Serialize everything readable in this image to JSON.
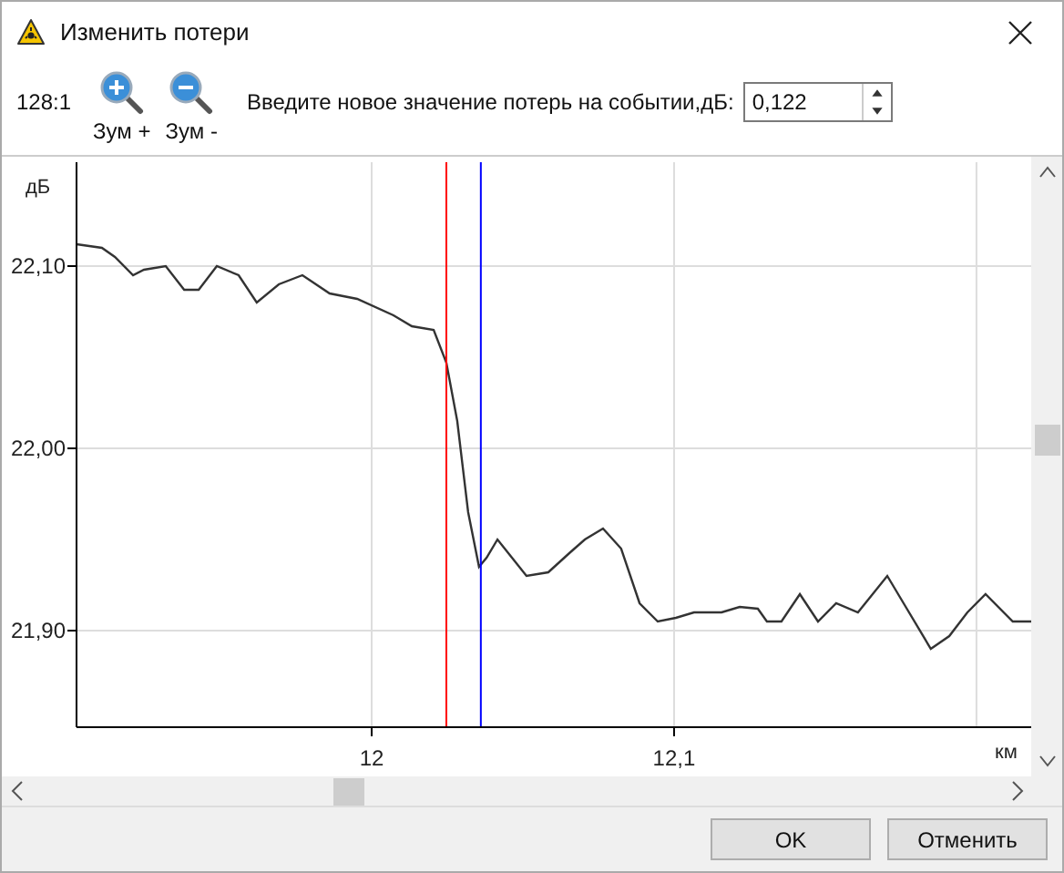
{
  "window": {
    "title": "Изменить потери"
  },
  "toolbar": {
    "scale": "128:1",
    "zoom_in": "Зум +",
    "zoom_out": "Зум -",
    "loss_label": "Введите новое значение потерь на событии,дБ:",
    "loss_value": "0,122"
  },
  "chart_data": {
    "type": "line",
    "xlabel": "км",
    "ylabel": "дБ",
    "xlim": [
      11.9024,
      12.2181
    ],
    "ylim": [
      21.847,
      22.157
    ],
    "x": [
      11.9024,
      11.9108,
      11.9151,
      11.9211,
      11.9247,
      11.9319,
      11.938,
      11.9428,
      11.9488,
      11.956,
      11.962,
      11.9693,
      11.9771,
      11.9861,
      11.9952,
      12.0072,
      12.0133,
      12.0205,
      12.0247,
      12.0283,
      12.0319,
      12.0355,
      12.038,
      12.0416,
      12.0464,
      12.0512,
      12.0584,
      12.0657,
      12.0705,
      12.0765,
      12.0825,
      12.0886,
      12.0946,
      12.1006,
      12.1066,
      12.1157,
      12.1217,
      12.1277,
      12.1307,
      12.1355,
      12.1416,
      12.1476,
      12.1536,
      12.1608,
      12.1705,
      12.1759,
      12.1849,
      12.191,
      12.197,
      12.203,
      12.212,
      12.2181
    ],
    "series": [
      {
        "color": "#333333",
        "values": [
          22.112,
          22.11,
          22.105,
          22.095,
          22.098,
          22.1,
          22.087,
          22.087,
          22.1,
          22.095,
          22.08,
          22.09,
          22.095,
          22.085,
          22.082,
          22.073,
          22.067,
          22.065,
          22.047,
          22.015,
          21.965,
          21.935,
          21.94,
          21.95,
          21.94,
          21.93,
          21.932,
          21.943,
          21.95,
          21.956,
          21.945,
          21.915,
          21.905,
          21.907,
          21.91,
          21.91,
          21.913,
          21.912,
          21.905,
          21.905,
          21.92,
          21.905,
          21.915,
          21.91,
          21.93,
          21.915,
          21.89,
          21.897,
          21.91,
          21.92,
          21.905,
          21.905
        ]
      }
    ],
    "xticks": [
      {
        "value": 12,
        "label": "12"
      },
      {
        "value": 12.1,
        "label": "12,1"
      }
    ],
    "yticks": [
      {
        "value": 21.9,
        "label": "21,90"
      },
      {
        "value": 22.0,
        "label": "22,00"
      },
      {
        "value": 22.1,
        "label": "22,10"
      }
    ],
    "grid": true,
    "ref_lines": [
      {
        "axis": "x",
        "value": 12.0247,
        "color": "#ff0000"
      },
      {
        "axis": "x",
        "value": 12.0361,
        "color": "#0000ff"
      }
    ]
  },
  "buttons": [
    "OK",
    "Отменить"
  ]
}
